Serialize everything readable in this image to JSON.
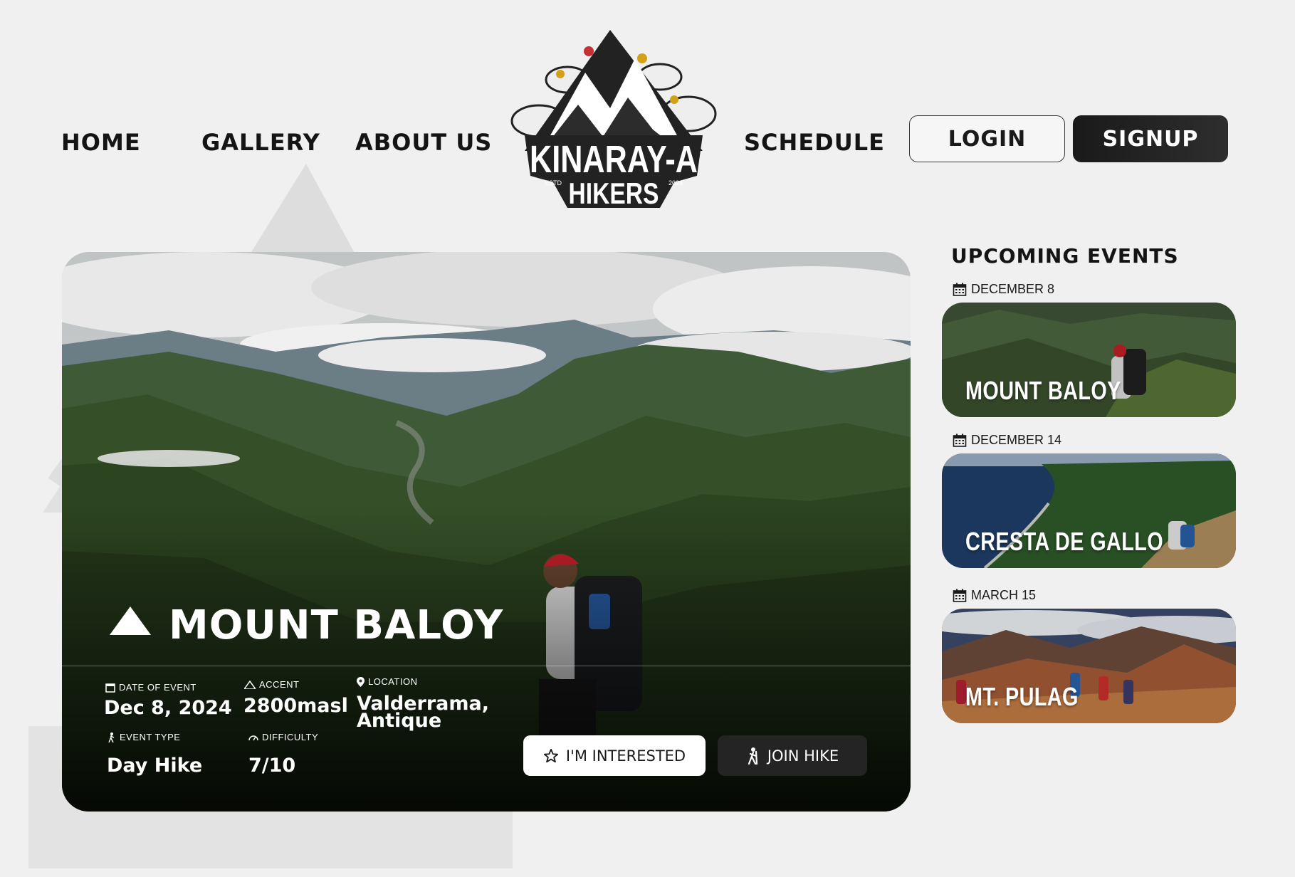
{
  "nav": {
    "home": "HOME",
    "gallery": "GALLERY",
    "about": "ABOUT US",
    "schedule": "SCHEDULE",
    "login": "LOGIN",
    "signup": "SIGNUP"
  },
  "logo": {
    "line1": "KINARAY-A",
    "line2": "HIKERS",
    "estd": "ESTD",
    "year": "2024"
  },
  "hero": {
    "title": "MOUNT BALOY",
    "date_label": "DATE OF EVENT",
    "date_value": "Dec 8, 2024",
    "accent_label": "ACCENT",
    "accent_value": "2800masl",
    "location_label": "LOCATION",
    "location_line1": "Valderrama,",
    "location_line2": "Antique",
    "type_label": "EVENT TYPE",
    "type_value": "Day Hike",
    "difficulty_label": "DIFFICULTY",
    "difficulty_value": "7/10",
    "interested_label": "I'M INTERESTED",
    "join_label": "JOIN HIKE"
  },
  "upcoming": {
    "title": "UPCOMING EVENTS",
    "events": [
      {
        "date": "DECEMBER 8",
        "name": "MOUNT BALOY"
      },
      {
        "date": "DECEMBER 14",
        "name": "CRESTA DE GALLO"
      },
      {
        "date": "MARCH 15",
        "name": "MT. PULAG"
      }
    ]
  },
  "colors": {
    "background": "#f0f0f0",
    "primary_dark": "#1a1a1a",
    "white": "#ffffff"
  }
}
